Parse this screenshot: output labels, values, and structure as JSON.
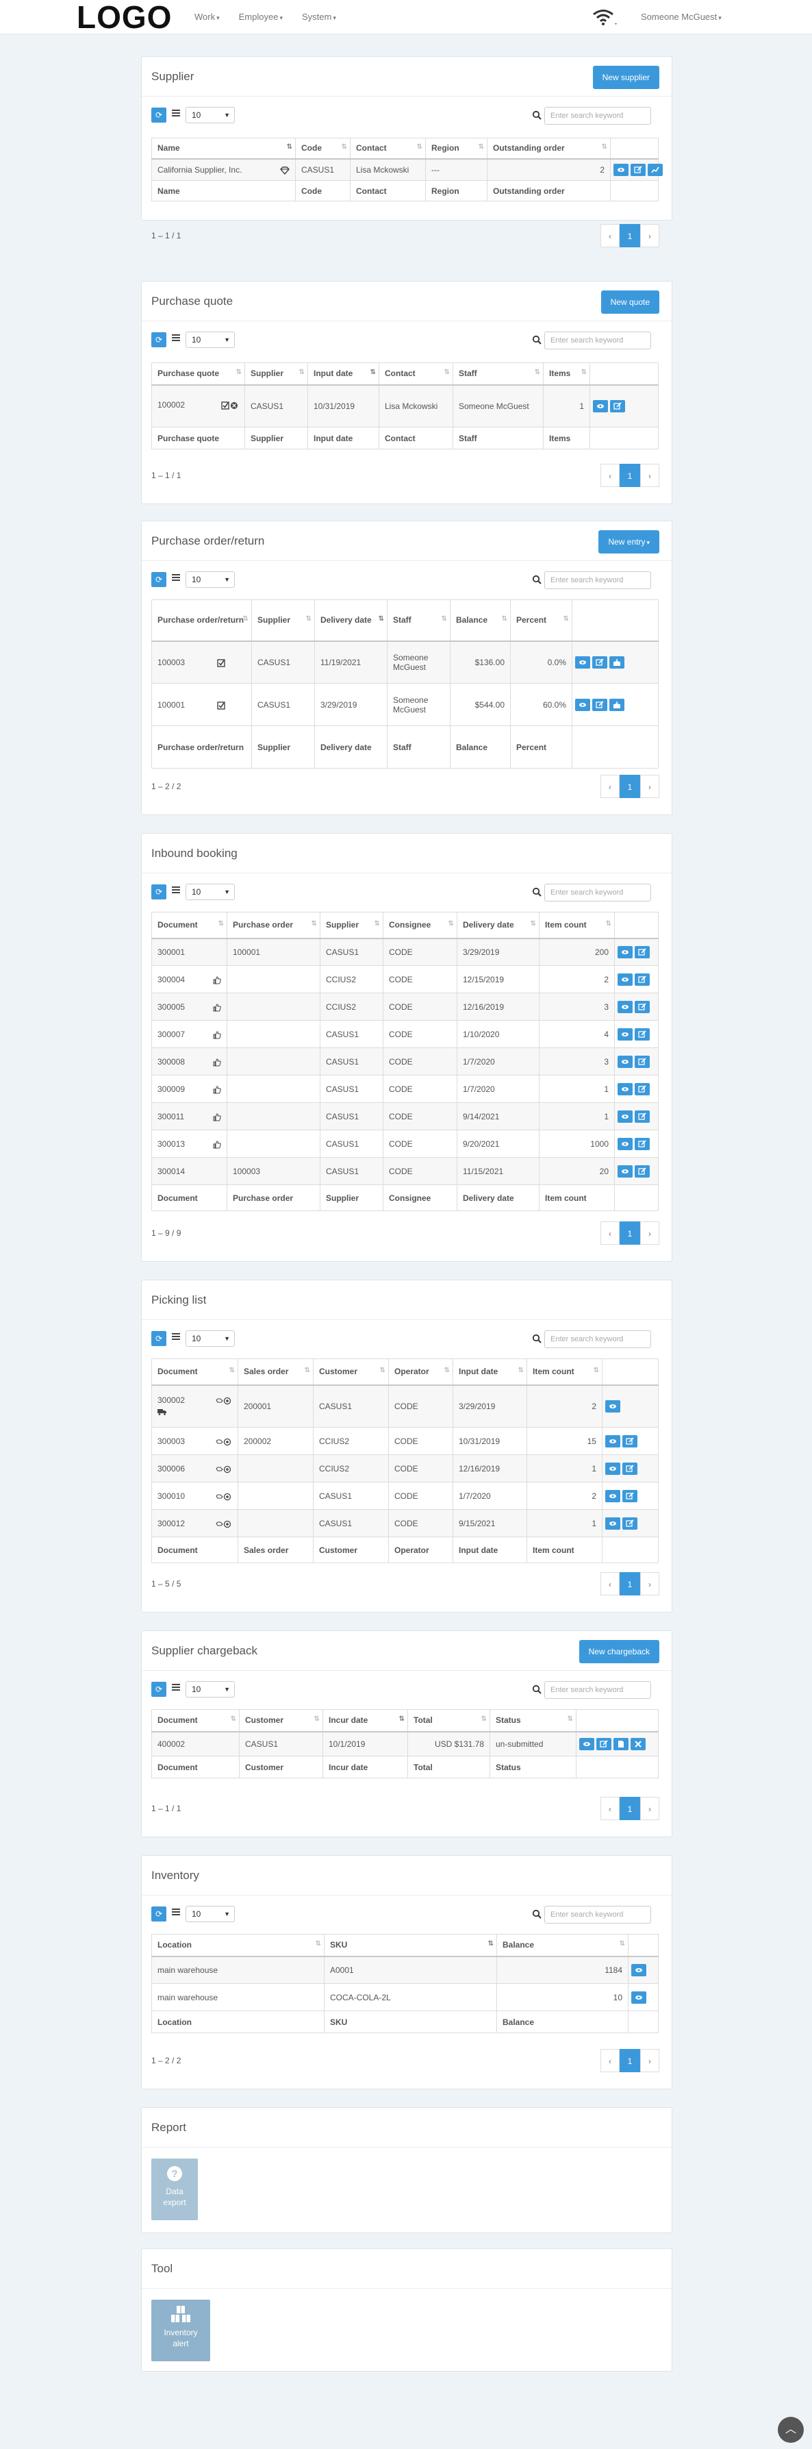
{
  "nav": {
    "logo": "LOGO",
    "menu": [
      {
        "label": "Work"
      },
      {
        "label": "Employee"
      },
      {
        "label": "System"
      }
    ],
    "user": "Someone McGuest"
  },
  "toolbar": {
    "page_size": "10",
    "search_placeholder": "Enter search keyword"
  },
  "supplier": {
    "title": "Supplier",
    "button": "New supplier",
    "headers": [
      "Name",
      "Code",
      "Contact",
      "Region",
      "Outstanding order"
    ],
    "rows": [
      {
        "name": "California Supplier, Inc.",
        "code": "CASUS1",
        "contact": "Lisa Mckowski",
        "region": "---",
        "outstanding": "2"
      }
    ],
    "footers": [
      "Name",
      "Code",
      "Contact",
      "Region",
      "Outstanding order"
    ],
    "range": "1 – 1 / 1",
    "page": "1"
  },
  "quote": {
    "title": "Purchase quote",
    "button": "New quote",
    "headers": [
      "Purchase quote",
      "Supplier",
      "Input date",
      "Contact",
      "Staff",
      "Items"
    ],
    "rows": [
      {
        "id": "100002",
        "supplier": "CASUS1",
        "date": "10/31/2019",
        "contact": "Lisa Mckowski",
        "staff": "Someone McGuest",
        "items": "1"
      }
    ],
    "footers": [
      "Purchase quote",
      "Supplier",
      "Input date",
      "Contact",
      "Staff",
      "Items"
    ],
    "range": "1 – 1 / 1",
    "page": "1"
  },
  "order": {
    "title": "Purchase order/return",
    "button": "New entry",
    "headers": [
      "Purchase order/return",
      "Supplier",
      "Delivery date",
      "Staff",
      "Balance",
      "Percent"
    ],
    "rows": [
      {
        "id": "100003",
        "supplier": "CASUS1",
        "date": "11/19/2021",
        "staff": "Someone McGuest",
        "balance": "$136.00",
        "percent": "0.0%"
      },
      {
        "id": "100001",
        "supplier": "CASUS1",
        "date": "3/29/2019",
        "staff": "Someone McGuest",
        "balance": "$544.00",
        "percent": "60.0%"
      }
    ],
    "footers": [
      "Purchase order/return",
      "Supplier",
      "Delivery date",
      "Staff",
      "Balance",
      "Percent"
    ],
    "range": "1 – 2 / 2",
    "page": "1"
  },
  "inbound": {
    "title": "Inbound booking",
    "headers": [
      "Document",
      "Purchase order",
      "Supplier",
      "Consignee",
      "Delivery date",
      "Item count"
    ],
    "rows": [
      {
        "doc": "300001",
        "po": "100001",
        "supplier": "CASUS1",
        "consignee": "CODE",
        "date": "3/29/2019",
        "count": "200"
      },
      {
        "doc": "300004",
        "po": "",
        "supplier": "CCIUS2",
        "consignee": "CODE",
        "date": "12/15/2019",
        "count": "2"
      },
      {
        "doc": "300005",
        "po": "",
        "supplier": "CCIUS2",
        "consignee": "CODE",
        "date": "12/16/2019",
        "count": "3"
      },
      {
        "doc": "300007",
        "po": "",
        "supplier": "CASUS1",
        "consignee": "CODE",
        "date": "1/10/2020",
        "count": "4"
      },
      {
        "doc": "300008",
        "po": "",
        "supplier": "CASUS1",
        "consignee": "CODE",
        "date": "1/7/2020",
        "count": "3"
      },
      {
        "doc": "300009",
        "po": "",
        "supplier": "CASUS1",
        "consignee": "CODE",
        "date": "1/7/2020",
        "count": "1"
      },
      {
        "doc": "300011",
        "po": "",
        "supplier": "CASUS1",
        "consignee": "CODE",
        "date": "9/14/2021",
        "count": "1"
      },
      {
        "doc": "300013",
        "po": "",
        "supplier": "CASUS1",
        "consignee": "CODE",
        "date": "9/20/2021",
        "count": "1000"
      },
      {
        "doc": "300014",
        "po": "100003",
        "supplier": "CASUS1",
        "consignee": "CODE",
        "date": "11/15/2021",
        "count": "20"
      }
    ],
    "footers": [
      "Document",
      "Purchase order",
      "Supplier",
      "Consignee",
      "Delivery date",
      "Item count"
    ],
    "range": "1 – 9 / 9",
    "page": "1"
  },
  "picking": {
    "title": "Picking list",
    "headers": [
      "Document",
      "Sales order",
      "Customer",
      "Operator",
      "Input date",
      "Item count"
    ],
    "rows": [
      {
        "doc": "300002",
        "so": "200001",
        "customer": "CASUS1",
        "operator": "CODE",
        "date": "3/29/2019",
        "count": "2"
      },
      {
        "doc": "300003",
        "so": "200002",
        "customer": "CCIUS2",
        "operator": "CODE",
        "date": "10/31/2019",
        "count": "15"
      },
      {
        "doc": "300006",
        "so": "",
        "customer": "CCIUS2",
        "operator": "CODE",
        "date": "12/16/2019",
        "count": "1"
      },
      {
        "doc": "300010",
        "so": "",
        "customer": "CASUS1",
        "operator": "CODE",
        "date": "1/7/2020",
        "count": "2"
      },
      {
        "doc": "300012",
        "so": "",
        "customer": "CASUS1",
        "operator": "CODE",
        "date": "9/15/2021",
        "count": "1"
      }
    ],
    "footers": [
      "Document",
      "Sales order",
      "Customer",
      "Operator",
      "Input date",
      "Item count"
    ],
    "range": "1 – 5 / 5",
    "page": "1"
  },
  "chargeback": {
    "title": "Supplier chargeback",
    "button": "New chargeback",
    "headers": [
      "Document",
      "Customer",
      "Incur date",
      "Total",
      "Status"
    ],
    "rows": [
      {
        "doc": "400002",
        "customer": "CASUS1",
        "date": "10/1/2019",
        "total": "USD $131.78",
        "status": "un-submitted"
      }
    ],
    "footers": [
      "Document",
      "Customer",
      "Incur date",
      "Total",
      "Status"
    ],
    "range": "1 – 1 / 1",
    "page": "1"
  },
  "inventory": {
    "title": "Inventory",
    "headers": [
      "Location",
      "SKU",
      "Balance"
    ],
    "rows": [
      {
        "location": "main warehouse",
        "sku": "A0001",
        "balance": "1184"
      },
      {
        "location": "main warehouse",
        "sku": "COCA-COLA-2L",
        "balance": "10"
      }
    ],
    "footers": [
      "Location",
      "SKU",
      "Balance"
    ],
    "range": "1 – 2 / 2",
    "page": "1"
  },
  "report": {
    "title": "Report",
    "tile": "Data export"
  },
  "tool": {
    "title": "Tool",
    "tile": "Inventory alert"
  },
  "colors": {
    "accent": "#3b99db",
    "tile": "#a8c3d6"
  }
}
